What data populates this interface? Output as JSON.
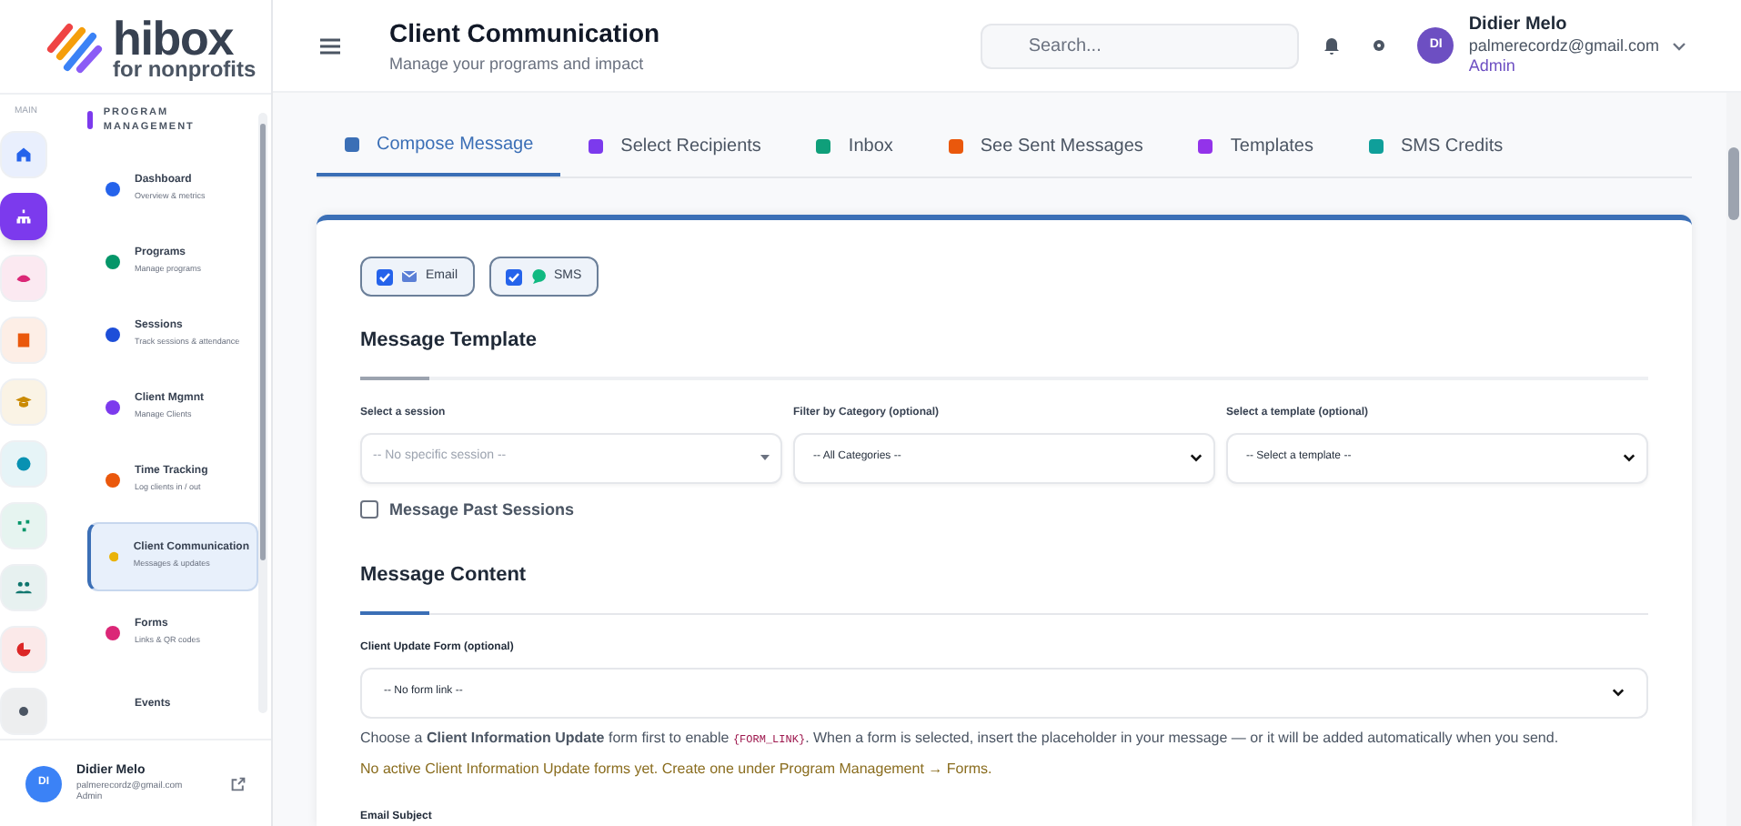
{
  "brand": {
    "name": "hibox",
    "tagline": "for nonprofits"
  },
  "rail": {
    "label": "MAIN",
    "items": [
      {
        "color": "#2563eb",
        "selected": false
      },
      {
        "color": "#7c3aed",
        "selected": true
      },
      {
        "color": "#db2777",
        "selected": false
      },
      {
        "color": "#ea580c",
        "selected": false
      },
      {
        "color": "#ca8a04",
        "selected": false
      },
      {
        "color": "#0891b2",
        "selected": false
      },
      {
        "color": "#059669",
        "selected": false
      },
      {
        "color": "#0f766e",
        "selected": false
      },
      {
        "color": "#dc2626",
        "selected": false
      },
      {
        "color": "#4b5563",
        "selected": false
      }
    ]
  },
  "submenu": {
    "title": "PROGRAM MANAGEMENT",
    "items": [
      {
        "label": "Dashboard",
        "sub": "Overview & metrics",
        "color": "#2563eb",
        "selected": false
      },
      {
        "label": "Programs",
        "sub": "Manage programs",
        "color": "#059669",
        "selected": false
      },
      {
        "label": "Sessions",
        "sub": "Track sessions & attendance",
        "color": "#1d4ed8",
        "selected": false
      },
      {
        "label": "Client Mgmnt",
        "sub": "Manage Clients",
        "color": "#7c3aed",
        "selected": false
      },
      {
        "label": "Time Tracking",
        "sub": "Log clients in / out",
        "color": "#ea580c",
        "selected": false
      },
      {
        "label": "Client Communication",
        "sub": "Messages & updates",
        "color": "#eab308",
        "selected": true
      },
      {
        "label": "Forms",
        "sub": "Links & QR codes",
        "color": "#db2777",
        "selected": false
      },
      {
        "label": "Events",
        "selected": false
      }
    ]
  },
  "sidebar_user": {
    "initials": "DI",
    "name": "Didier Melo",
    "email": "palmerecordz@gmail.com",
    "role": "Admin"
  },
  "header": {
    "title": "Client Communication",
    "subtitle": "Manage your programs and impact",
    "search": {
      "placeholder": "Search..."
    },
    "user": {
      "initials": "DI",
      "name": "Didier Melo",
      "email": "palmerecordz@gmail.com",
      "role": "Admin"
    }
  },
  "tabs": [
    {
      "label": "Compose Message",
      "color": "#3b6fb6",
      "selected": true
    },
    {
      "label": "Select Recipients",
      "color": "#7c3aed",
      "selected": false
    },
    {
      "label": "Inbox",
      "color": "#0f9f7a",
      "selected": false
    },
    {
      "label": "See Sent Messages",
      "color": "#ea580c",
      "selected": false
    },
    {
      "label": "Templates",
      "color": "#9333ea",
      "selected": false
    },
    {
      "label": "SMS Credits",
      "color": "#0f9f9a",
      "selected": false
    }
  ],
  "channels": [
    {
      "label": "Email",
      "checked": true
    },
    {
      "label": "SMS",
      "checked": true
    }
  ],
  "template_section": {
    "title": "Message Template",
    "fields": [
      {
        "label": "Select a session",
        "value": "-- No specific session --",
        "disabled": true
      },
      {
        "label": "Filter by Category (optional)",
        "value": "-- All Categories --",
        "disabled": false
      },
      {
        "label": "Select a template (optional)",
        "value": "-- Select a template --",
        "disabled": false
      }
    ],
    "past_sessions": {
      "label": "Message Past Sessions",
      "checked": false
    }
  },
  "content_section": {
    "title": "Message Content",
    "form_field": {
      "label": "Client Update Form (optional)",
      "value": "-- No form link --"
    },
    "hint": {
      "before": "Choose a **Client Information Update** form first to enable ",
      "code": "{FORM_LINK}",
      "after": ". When a form is selected, insert the placeholder in your message — or it will be added automatically when you send."
    },
    "warning": "No active Client Information Update forms yet. Create one under Program Management → Forms.",
    "next_label": "Email Subject"
  }
}
